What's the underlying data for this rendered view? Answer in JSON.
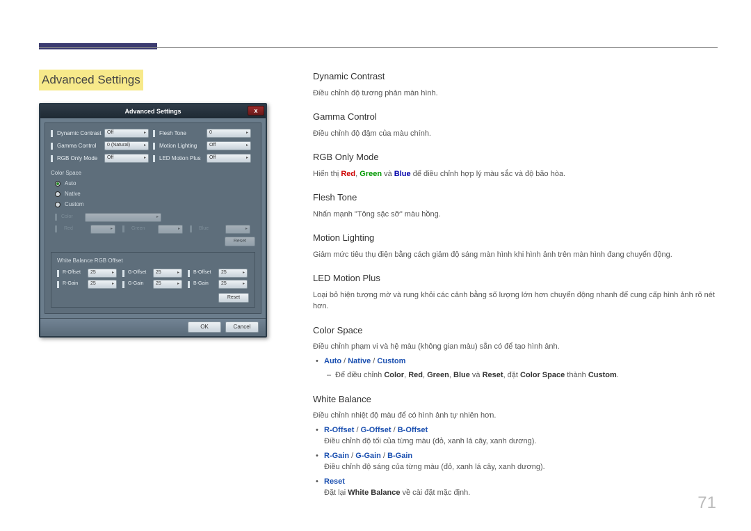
{
  "page_number": "71",
  "section_title": "Advanced Settings",
  "osd": {
    "title": "Advanced Settings",
    "close": "x",
    "rows_left": [
      {
        "label": "Dynamic Contrast",
        "value": "Off"
      },
      {
        "label": "Gamma Control",
        "value": "0 (Natural)"
      },
      {
        "label": "RGB Only Mode",
        "value": "Off"
      }
    ],
    "rows_right": [
      {
        "label": "Flesh Tone",
        "value": "0"
      },
      {
        "label": "Motion Lighting",
        "value": "Off"
      },
      {
        "label": "LED Motion Plus",
        "value": "Off"
      }
    ],
    "color_space_label": "Color Space",
    "radios": [
      "Auto",
      "Native",
      "Custom"
    ],
    "radio_selected": 0,
    "color_label": "Color",
    "rgb_row": [
      "Red",
      "Green",
      "Blue"
    ],
    "reset_label": "Reset",
    "wb_head": "White Balance RGB Offset",
    "wb_rows": [
      [
        {
          "label": "R-Offset",
          "value": "25"
        },
        {
          "label": "G-Offset",
          "value": "25"
        },
        {
          "label": "B-Offset",
          "value": "25"
        }
      ],
      [
        {
          "label": "R-Gain",
          "value": "25"
        },
        {
          "label": "G-Gain",
          "value": "25"
        },
        {
          "label": "B-Gain",
          "value": "25"
        }
      ]
    ],
    "ok": "OK",
    "cancel": "Cancel"
  },
  "desc": {
    "dynamic_contrast": {
      "h": "Dynamic Contrast",
      "p": "Điều chỉnh độ tương phản màn hình."
    },
    "gamma": {
      "h": "Gamma Control",
      "p": "Điều chỉnh độ đậm của màu chính."
    },
    "rgb_only": {
      "h": "RGB Only Mode",
      "p1": "Hiển thị ",
      "p2": " và ",
      "p3": " để điều chỉnh hợp lý màu sắc và độ bão hòa.",
      "red": "Red",
      "green": "Green",
      "blue": "Blue",
      "comma": ", "
    },
    "flesh": {
      "h": "Flesh Tone",
      "p": "Nhấn mạnh \"Tông sặc sỡ\" màu hồng."
    },
    "motion": {
      "h": "Motion Lighting",
      "p": "Giảm mức tiêu thụ điện bằng cách giảm độ sáng màn hình khi hình ảnh trên màn hình đang chuyển động."
    },
    "led": {
      "h": "LED Motion Plus",
      "p": "Loại bỏ hiện tượng mờ và rung khỏi các cảnh bằng số lượng lớn hơn chuyển động nhanh để cung cấp hình ảnh rõ nét hơn."
    },
    "cspace": {
      "h": "Color Space",
      "p": "Điều chỉnh phạm vi và hệ màu (không gian màu) sẵn có để tạo hình ảnh.",
      "auto": "Auto",
      "native": "Native",
      "custom": "Custom",
      "slash": " / ",
      "sub_pre": "Để điều chỉnh ",
      "sub_color": "Color",
      "sub_c": ", ",
      "sub_red": "Red",
      "sub_green": "Green",
      "sub_blue": "Blue",
      "sub_and": " và ",
      "sub_reset": "Reset",
      "sub_mid": ", đặt ",
      "sub_cs": "Color Space",
      "sub_to": " thành ",
      "sub_custom": "Custom",
      "sub_end": "."
    },
    "wb": {
      "h": "White Balance",
      "p": "Điều chỉnh nhiệt độ màu để có hình ảnh tự nhiên hơn.",
      "offset": {
        "r": "R-Offset",
        "g": "G-Offset",
        "b": "B-Offset",
        "desc": "Điều chỉnh độ tối của từng màu (đỏ, xanh lá cây, xanh dương)."
      },
      "gain": {
        "r": "R-Gain",
        "g": "G-Gain",
        "b": "B-Gain",
        "desc": "Điều chỉnh độ sáng của từng màu (đỏ, xanh lá cây, xanh dương)."
      },
      "reset": {
        "label": "Reset",
        "desc_pre": "Đặt lại ",
        "desc_wb": "White Balance",
        "desc_post": " về cài đặt mặc định."
      },
      "slash": " / "
    }
  }
}
